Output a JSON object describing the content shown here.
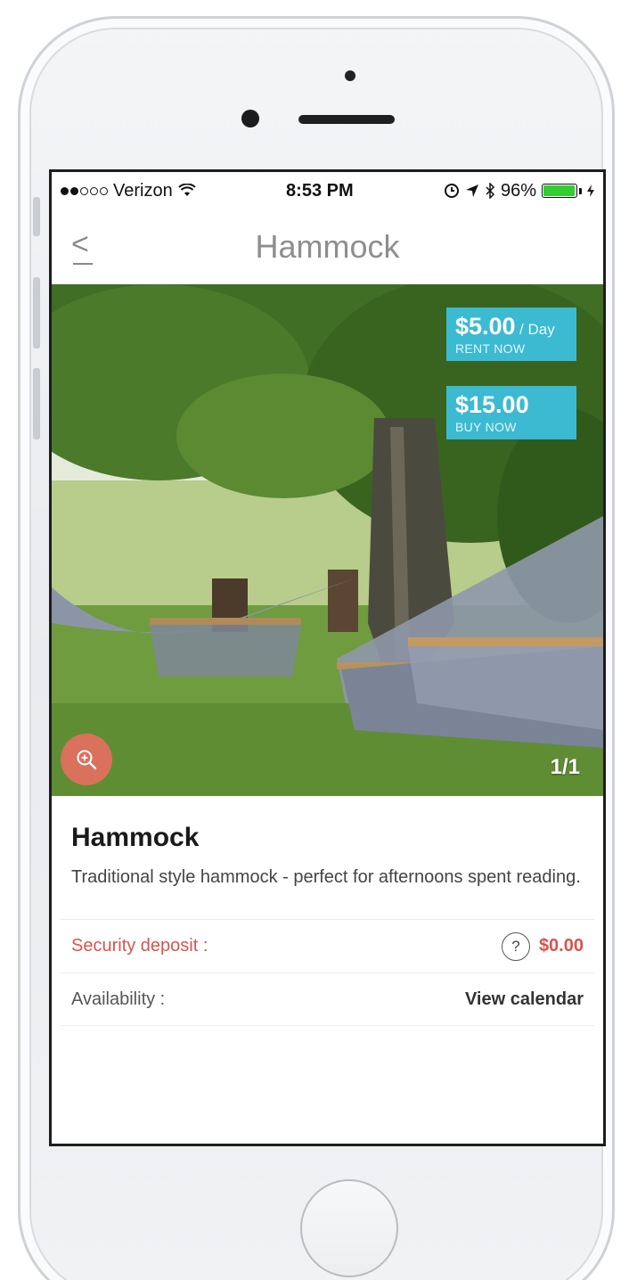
{
  "status_bar": {
    "carrier": "Verizon",
    "time": "8:53 PM",
    "battery": "96%",
    "battery_level": 0.96,
    "icons": [
      "wifi-icon",
      "location-icon",
      "alarm-icon",
      "bluetooth-icon",
      "charging-icon"
    ]
  },
  "nav": {
    "back_glyph": "<",
    "title": "Hammock"
  },
  "photo": {
    "rent": {
      "amount": "$5.00",
      "unit": "/ Day",
      "cta": "RENT NOW"
    },
    "buy": {
      "amount": "$15.00",
      "cta": "BUY NOW"
    },
    "counter": "1/1"
  },
  "item": {
    "title": "Hammock",
    "description": "Traditional style hammock - perfect for afternoons spent reading."
  },
  "deposit": {
    "label": "Security deposit :",
    "help": "?",
    "value": "$0.00"
  },
  "availability": {
    "label": "Availability :",
    "link": "View calendar"
  },
  "colors": {
    "accent_price": "#3bbad2",
    "deposit_red": "#d9534f",
    "zoom_button": "#d9715d",
    "battery_green": "#33cc33"
  }
}
